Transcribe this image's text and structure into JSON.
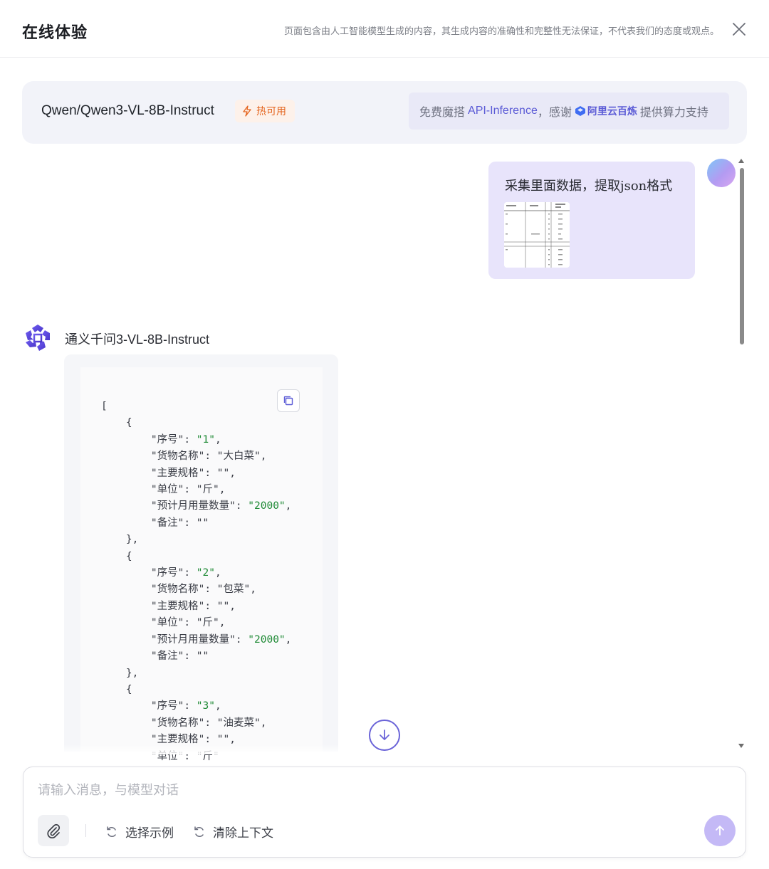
{
  "header": {
    "title": "在线体验",
    "disclaimer": "页面包含由人工智能模型生成的内容，其生成内容的准确性和完整性无法保证，不代表我们的态度或观点。",
    "close_icon": "close-icon"
  },
  "model_bar": {
    "model_name": "Qwen/Qwen3-VL-8B-Instruct",
    "hot_badge": "热可用",
    "api_prefix": "免费魔搭",
    "api_name": "API-Inference",
    "api_thanks": "，感谢",
    "brand": "阿里云百炼",
    "api_suffix": "提供算力支持"
  },
  "user_message": {
    "text": "采集里面数据，提取json格式",
    "attachment": "table-image-thumbnail"
  },
  "assistant": {
    "name": "通义千问3-VL-8B-Instruct",
    "code": {
      "open": "[",
      "items": [
        {
          "序号": "1",
          "货物名称": "大白菜",
          "主要规格": "",
          "单位": "斤",
          "预计月用量数量": "2000",
          "备注": ""
        },
        {
          "序号": "2",
          "货物名称": "包菜",
          "主要规格": "",
          "单位": "斤",
          "预计月用量数量": "2000",
          "备注": ""
        },
        {
          "序号": "3",
          "货物名称": "油麦菜",
          "主要规格": "",
          "单位": "斤"
        }
      ]
    }
  },
  "composer": {
    "placeholder": "请输入消息，与模型对话",
    "select_example": "选择示例",
    "clear_context": "清除上下文"
  },
  "colors": {
    "accent": "#5b5bd6",
    "hot": "#e4631c",
    "user_bubble": "#e8e4fb",
    "json_value": "#1e8a35",
    "send_button": "#c4b9f6"
  }
}
